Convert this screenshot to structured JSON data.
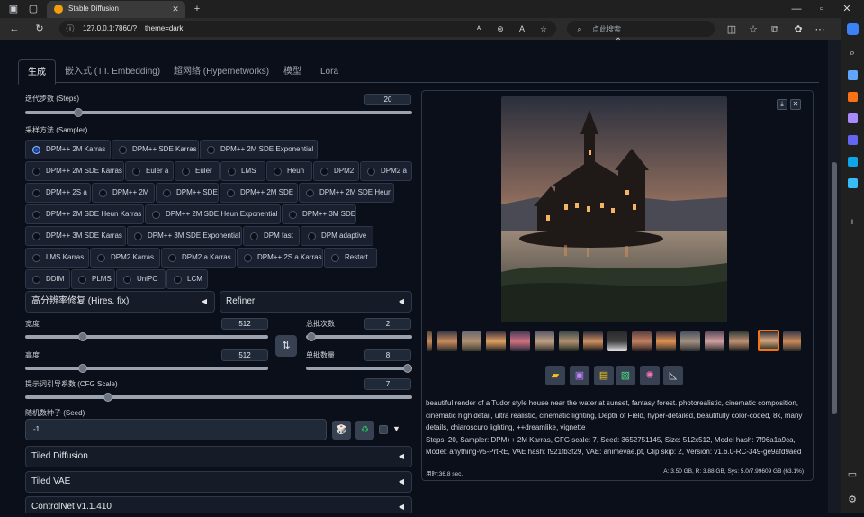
{
  "browser": {
    "tab_title": "Stable Diffusion",
    "url": "127.0.0.1:7860/?__theme=dark",
    "search_placeholder": "点此搜索"
  },
  "tabs": [
    {
      "label": "生成"
    },
    {
      "label": "嵌入式 (T.I. Embedding)"
    },
    {
      "label": "超网络 (Hypernetworks)"
    },
    {
      "label": "模型"
    },
    {
      "label": "Lora"
    }
  ],
  "steps": {
    "label": "迭代步数 (Steps)",
    "value": "20",
    "min": 1,
    "max": 150
  },
  "sampler": {
    "label": "采样方法 (Sampler)",
    "selected": "DPM++ 2M Karras",
    "options": [
      "DPM++ 2M Karras",
      "DPM++ SDE Karras",
      "DPM++ 2M SDE Exponential",
      "DPM++ 2M SDE Karras",
      "Euler a",
      "Euler",
      "LMS",
      "Heun",
      "DPM2",
      "DPM2 a",
      "DPM++ 2S a",
      "DPM++ 2M",
      "DPM++ SDE",
      "DPM++ 2M SDE",
      "DPM++ 2M SDE Heun",
      "DPM++ 2M SDE Heun Karras",
      "DPM++ 2M SDE Heun Exponential",
      "DPM++ 3M SDE",
      "DPM++ 3M SDE Karras",
      "DPM++ 3M SDE Exponential",
      "DPM fast",
      "DPM adaptive",
      "LMS Karras",
      "DPM2 Karras",
      "DPM2 a Karras",
      "DPM++ 2S a Karras",
      "Restart",
      "DDIM",
      "PLMS",
      "UniPC",
      "LCM"
    ]
  },
  "hires": {
    "label": "高分辨率修复 (Hires. fix)"
  },
  "refiner": {
    "label": "Refiner"
  },
  "width": {
    "label": "宽度",
    "value": "512"
  },
  "height": {
    "label": "高度",
    "value": "512"
  },
  "batch_count": {
    "label": "总批次数",
    "value": "2"
  },
  "batch_size": {
    "label": "单批数量",
    "value": "8"
  },
  "cfg": {
    "label": "提示词引导系数 (CFG Scale)",
    "value": "7"
  },
  "seed": {
    "label": "随机数种子 (Seed)",
    "value": "-1"
  },
  "accordions": [
    {
      "label": "Tiled Diffusion"
    },
    {
      "label": "Tiled VAE"
    },
    {
      "label": "ControlNet v1.1.410"
    }
  ],
  "output": {
    "info": "beautiful render of a Tudor style house near the water at sunset, fantasy forest. photorealistic, cinematic composition, cinematic high detail, ultra realistic, cinematic lighting, Depth of Field, hyper-detailed, beautifully color-coded, 8k, many details, chiaroscuro lighting, ++dreamlike, vignette",
    "params_line1": "Steps: 20, Sampler: DPM++ 2M Karras, CFG scale: 7, Seed: 3652751145, Size: 512x512, Model hash: 7f96a1a9ca,",
    "params_line2": "Model: anything-v5-PrtRE, VAE hash: f921fb3f29, VAE: animevae.pt, Clip skip: 2, Version: v1.6.0-RC-349-ge9afd9aed",
    "time": "用时:36.8 sec.",
    "memory": "A: 3.50 GB, R: 3.88 GB, Sys: 5.0/7.99609 GB (63.1%)"
  },
  "colors": {
    "accent": "#2563eb",
    "bg": "#0b0f19",
    "panel": "#151b27",
    "selected_thumb": "#f97316"
  },
  "icons": [
    "folder-icon",
    "save-icon",
    "zip-icon",
    "image-icon",
    "palette-icon",
    "ruler-icon"
  ]
}
